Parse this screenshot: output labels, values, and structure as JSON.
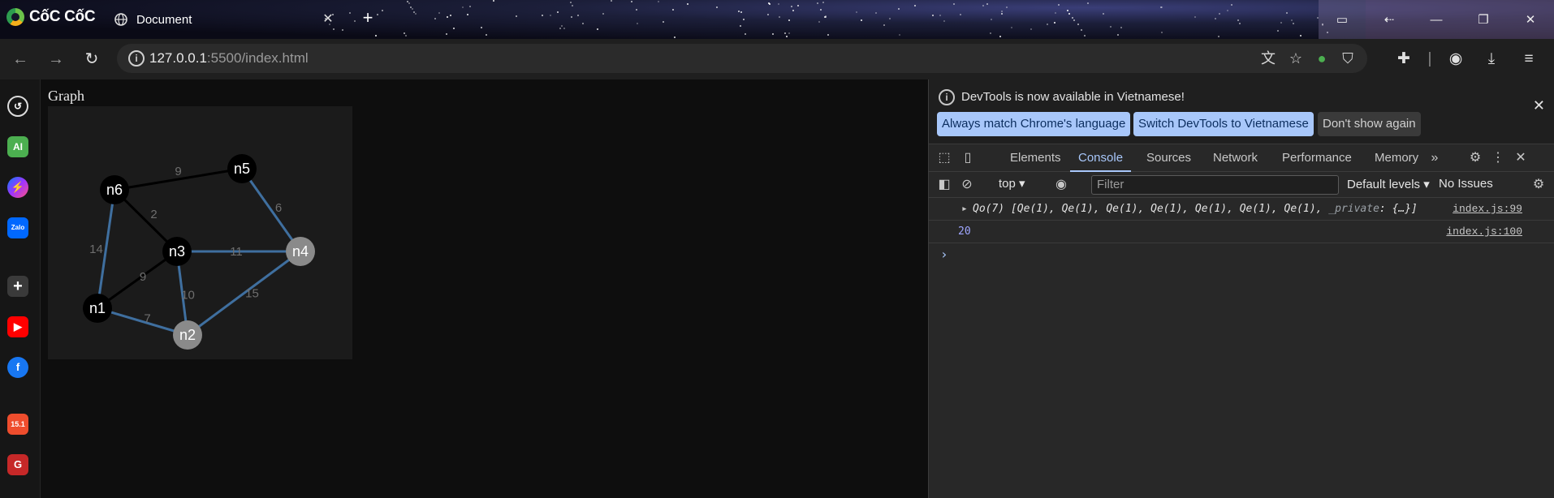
{
  "browser": {
    "brand_name": "CốC CốC",
    "tab_title": "Document",
    "tab_close": "✕",
    "new_tab": "+",
    "url_host": "127.0.0.1",
    "url_rest": ":5500/index.html"
  },
  "page": {
    "heading": "Graph",
    "graph": {
      "nodes": [
        {
          "id": "n1",
          "fill": "#000000"
        },
        {
          "id": "n2",
          "fill": "#8a8a8a"
        },
        {
          "id": "n3",
          "fill": "#000000"
        },
        {
          "id": "n4",
          "fill": "#8a8a8a"
        },
        {
          "id": "n5",
          "fill": "#000000"
        },
        {
          "id": "n6",
          "fill": "#000000"
        }
      ],
      "edges": [
        {
          "from": "n6",
          "to": "n5",
          "weight": "9",
          "highlight": false
        },
        {
          "from": "n6",
          "to": "n3",
          "weight": "2",
          "highlight": false
        },
        {
          "from": "n6",
          "to": "n1",
          "weight": "14",
          "highlight": true
        },
        {
          "from": "n5",
          "to": "n4",
          "weight": "6",
          "highlight": true
        },
        {
          "from": "n3",
          "to": "n4",
          "weight": "11",
          "highlight": true
        },
        {
          "from": "n3",
          "to": "n1",
          "weight": "9",
          "highlight": false
        },
        {
          "from": "n3",
          "to": "n2",
          "weight": "10",
          "highlight": true
        },
        {
          "from": "n4",
          "to": "n2",
          "weight": "15",
          "highlight": true
        },
        {
          "from": "n1",
          "to": "n2",
          "weight": "7",
          "highlight": true
        }
      ],
      "colors": {
        "highlight_edge": "#3f6f9f",
        "normal_edge": "#000000",
        "weight_label": "#6e6e6e"
      }
    }
  },
  "devtools": {
    "banner_text": "DevTools is now available in Vietnamese!",
    "banner_buttons": [
      "Always match Chrome's language",
      "Switch DevTools to Vietnamese",
      "Don't show again"
    ],
    "tabs": [
      "Elements",
      "Console",
      "Sources",
      "Network",
      "Performance",
      "Memory"
    ],
    "active_tab": "Console",
    "context": "top",
    "filter_placeholder": "Filter",
    "levels": "Default levels",
    "issues": "No Issues",
    "logs": [
      {
        "text": "Qo(7) [Qe(1), Qe(1), Qe(1), Qe(1), Qe(1), Qe(1), Qe(1), ",
        "private": "_private",
        "tail": ": {…}]",
        "source": "index.js:99"
      },
      {
        "text": "20",
        "source": "index.js:100"
      }
    ],
    "prompt": "›"
  }
}
